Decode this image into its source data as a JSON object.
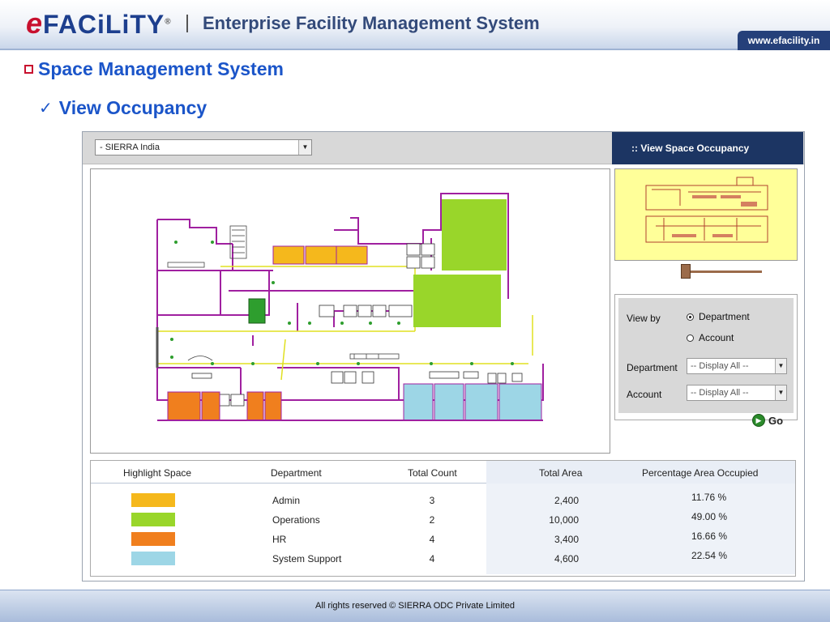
{
  "header": {
    "logo_e": "e",
    "logo_rest": "FACiLiTY",
    "logo_reg": "®",
    "title": "Enterprise Facility Management System",
    "website": "www.efacility.in"
  },
  "headings": {
    "section": "Space Management System",
    "subsection": "View Occupancy",
    "check_icon": "✓"
  },
  "app": {
    "location_select": "- SIERRA India",
    "view_button": "::  View Space Occupancy",
    "filters": {
      "view_by_label": "View by",
      "radio_department": "Department",
      "radio_account": "Account",
      "selected_view": "Department",
      "department_label": "Department",
      "department_value": "-- Display All --",
      "account_label": "Account",
      "account_value": "-- Display All --",
      "go_label": "Go"
    },
    "table": {
      "headers": {
        "highlight": "Highlight Space",
        "department": "Department",
        "count": "Total Count",
        "area": "Total Area",
        "percent": "Percentage Area Occupied"
      },
      "rows": [
        {
          "color": "#f5b81c",
          "department": "Admin",
          "count": "3",
          "area": "2,400",
          "percent": "11.76 %"
        },
        {
          "color": "#99d62a",
          "department": "Operations",
          "count": "2",
          "area": "10,000",
          "percent": "49.00 %"
        },
        {
          "color": "#f07f1e",
          "department": "HR",
          "count": "4",
          "area": "3,400",
          "percent": "16.66 %"
        },
        {
          "color": "#9dd6e6",
          "department": "System Support",
          "count": "4",
          "area": "4,600",
          "percent": "22.54 %"
        }
      ]
    }
  },
  "footer": {
    "text": "All rights reserved © SIERRA ODC Private Limited"
  }
}
